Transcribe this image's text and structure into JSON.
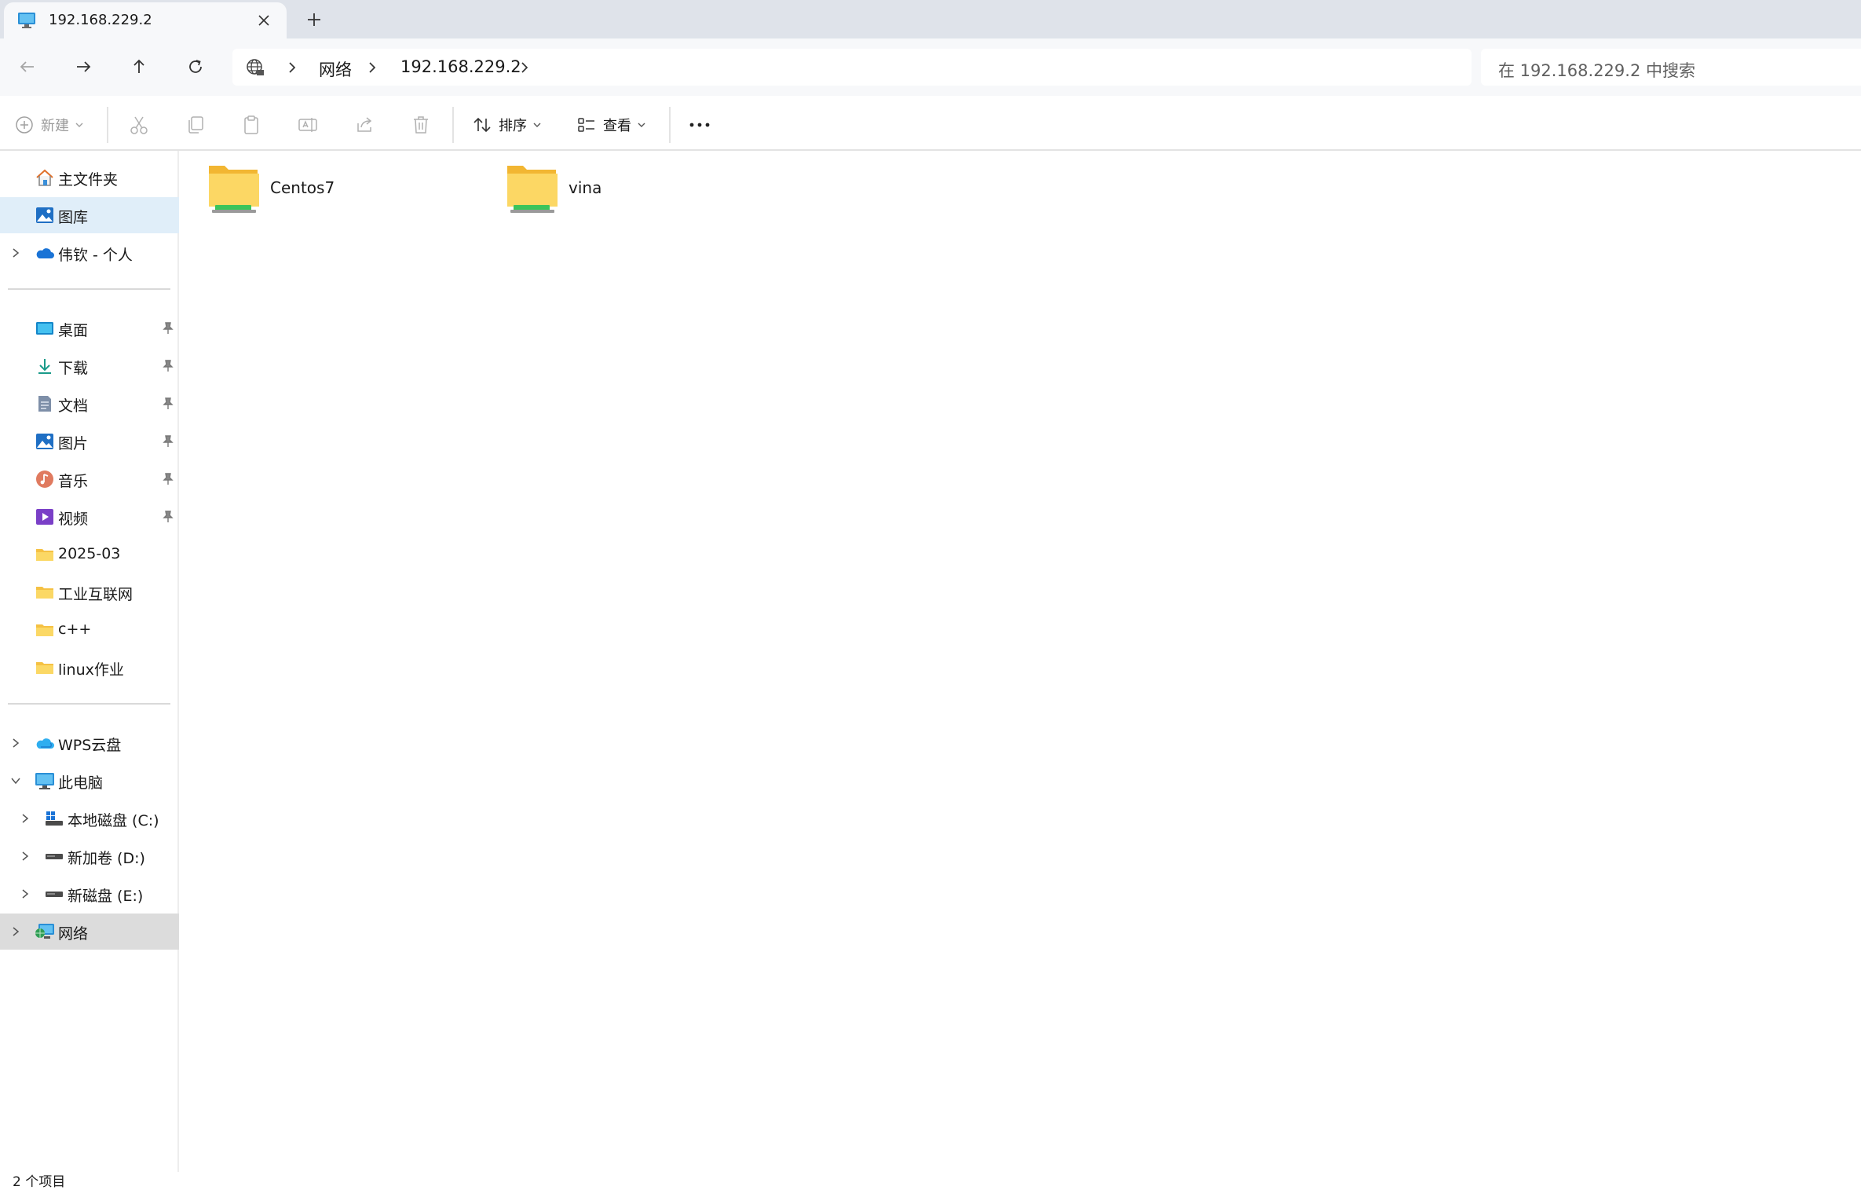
{
  "tab": {
    "title": "192.168.229.2",
    "icon": "monitor-icon"
  },
  "address": {
    "segments": [
      "网络",
      "192.168.229.2"
    ],
    "search_placeholder": "在 192.168.229.2 中搜索"
  },
  "toolbar": {
    "new_label": "新建",
    "sort_label": "排序",
    "view_label": "查看"
  },
  "sidebar": {
    "top_items": [
      {
        "label": "主文件夹",
        "icon": "home-icon"
      },
      {
        "label": "图库",
        "icon": "gallery-icon",
        "selected": true
      },
      {
        "label": "伟钦 - 个人",
        "icon": "onedrive-icon",
        "expandable": true
      }
    ],
    "pinned_items": [
      {
        "label": "桌面",
        "icon": "desktop-icon"
      },
      {
        "label": "下载",
        "icon": "download-icon"
      },
      {
        "label": "文档",
        "icon": "document-icon"
      },
      {
        "label": "图片",
        "icon": "pictures-icon"
      },
      {
        "label": "音乐",
        "icon": "music-icon"
      },
      {
        "label": "视频",
        "icon": "video-icon"
      }
    ],
    "folders": [
      {
        "label": "2025-03",
        "icon": "folder-icon"
      },
      {
        "label": "工业互联网",
        "icon": "folder-icon"
      },
      {
        "label": "c++",
        "icon": "folder-icon"
      },
      {
        "label": "linux作业",
        "icon": "folder-icon"
      }
    ],
    "bottom_items": [
      {
        "label": "WPS云盘",
        "icon": "wps-cloud-icon"
      },
      {
        "label": "此电脑",
        "icon": "this-pc-icon"
      },
      {
        "label": "本地磁盘 (C:)",
        "icon": "windows-drive-icon"
      },
      {
        "label": "新加卷 (D:)",
        "icon": "drive-icon"
      },
      {
        "label": "新磁盘 (E:)",
        "icon": "drive-icon"
      },
      {
        "label": "网络",
        "icon": "network-icon"
      }
    ]
  },
  "content": {
    "items": [
      {
        "name": "Centos7",
        "icon": "network-share-folder-icon"
      },
      {
        "name": "vina",
        "icon": "network-share-folder-icon"
      }
    ]
  },
  "status": {
    "text": "2 个项目"
  },
  "colors": {
    "tabbar_bg": "#dfe3ea",
    "selected_bg": "#e0eef9",
    "hover_bg": "#dcdcdc",
    "folder_yellow": "#f8ce4c",
    "share_green": "#3cc45b"
  }
}
